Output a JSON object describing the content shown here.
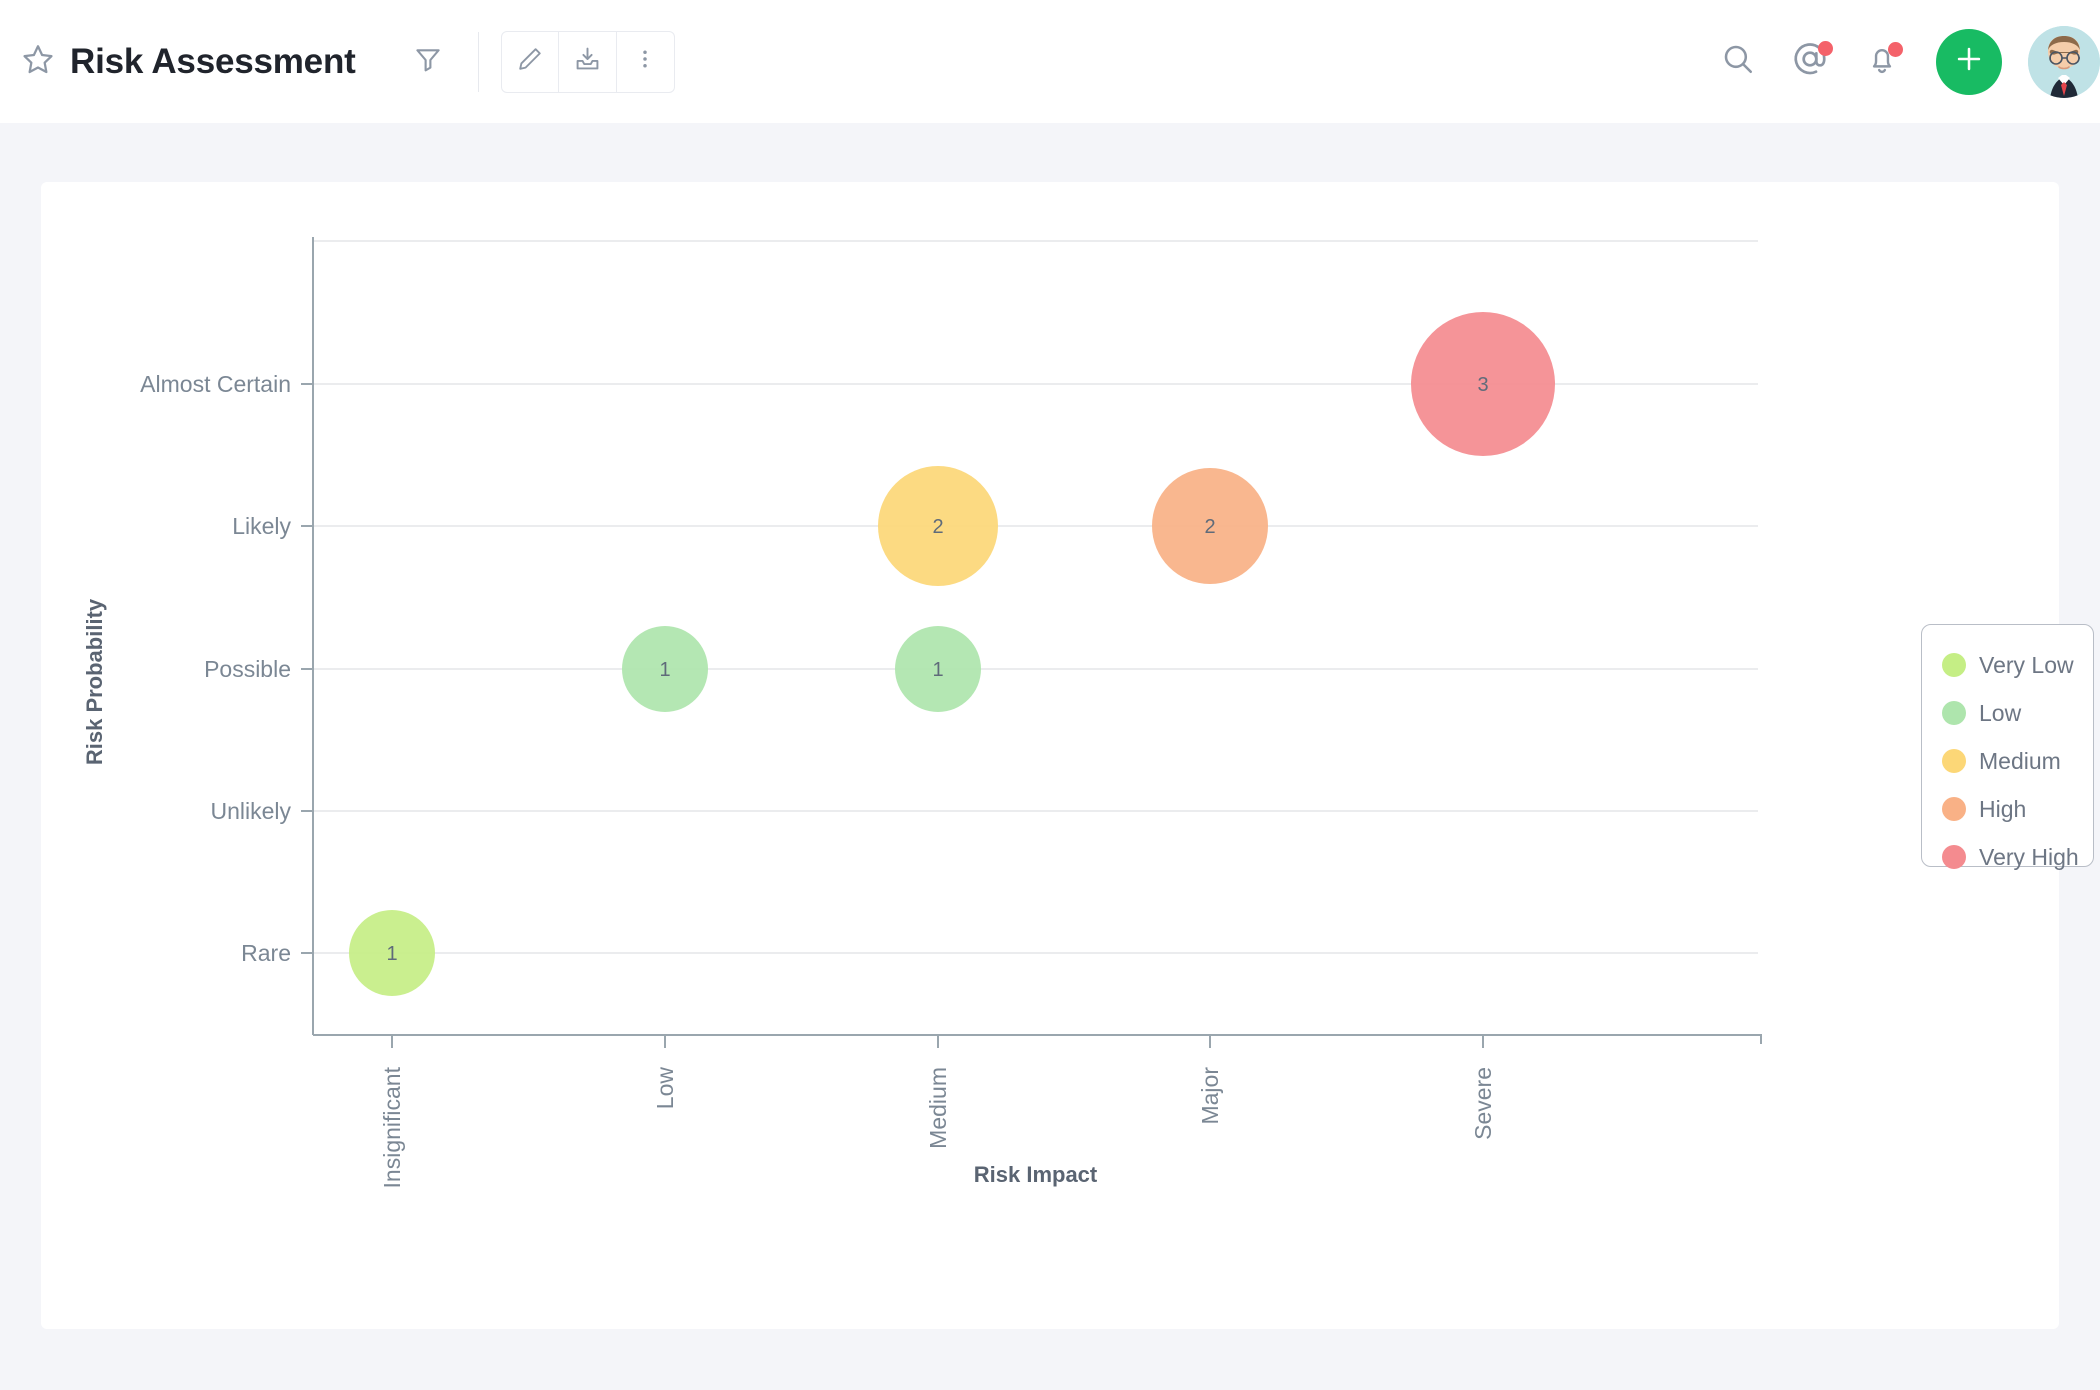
{
  "header": {
    "title": "Risk Assessment",
    "star_icon": "star-icon",
    "filter_icon": "filter-icon",
    "edit_icon": "pencil-icon",
    "export_icon": "export-download-icon",
    "more_icon": "more-vertical-icon",
    "search_icon": "search-icon",
    "mentions_icon": "at-mention-icon",
    "notifications_icon": "bell-icon",
    "add_label": "+",
    "avatar_label": "user-avatar"
  },
  "legend": {
    "items": [
      {
        "label": "Very Low",
        "color": "#c5ee85"
      },
      {
        "label": "Low",
        "color": "#aee5ad"
      },
      {
        "label": "Medium",
        "color": "#fcd777"
      },
      {
        "label": "High",
        "color": "#f9b186"
      },
      {
        "label": "Very High",
        "color": "#f48b8f"
      }
    ]
  },
  "chart_data": {
    "type": "scatter",
    "title": "",
    "xlabel": "Risk Impact",
    "ylabel": "Risk Probability",
    "grid": true,
    "legend_position": "right",
    "categories_x": [
      "Insignificant",
      "Low",
      "Medium",
      "Major",
      "Severe"
    ],
    "categories_y": [
      "Rare",
      "Unlikely",
      "Possible",
      "Likely",
      "Almost Certain"
    ],
    "points": [
      {
        "x": "Insignificant",
        "y": "Rare",
        "value": 1,
        "series": "Very Low",
        "color": "#c5ee85",
        "radius": 43
      },
      {
        "x": "Low",
        "y": "Possible",
        "value": 1,
        "series": "Low",
        "color": "#aee5ad",
        "radius": 43
      },
      {
        "x": "Medium",
        "y": "Possible",
        "value": 1,
        "series": "Low",
        "color": "#aee5ad",
        "radius": 43
      },
      {
        "x": "Medium",
        "y": "Likely",
        "value": 2,
        "series": "Medium",
        "color": "#fcd777",
        "radius": 60
      },
      {
        "x": "Major",
        "y": "Likely",
        "value": 2,
        "series": "High",
        "color": "#f9b186",
        "radius": 58
      },
      {
        "x": "Severe",
        "y": "Almost Certain",
        "value": 3,
        "series": "Very High",
        "color": "#f48b8f",
        "radius": 72
      }
    ]
  }
}
